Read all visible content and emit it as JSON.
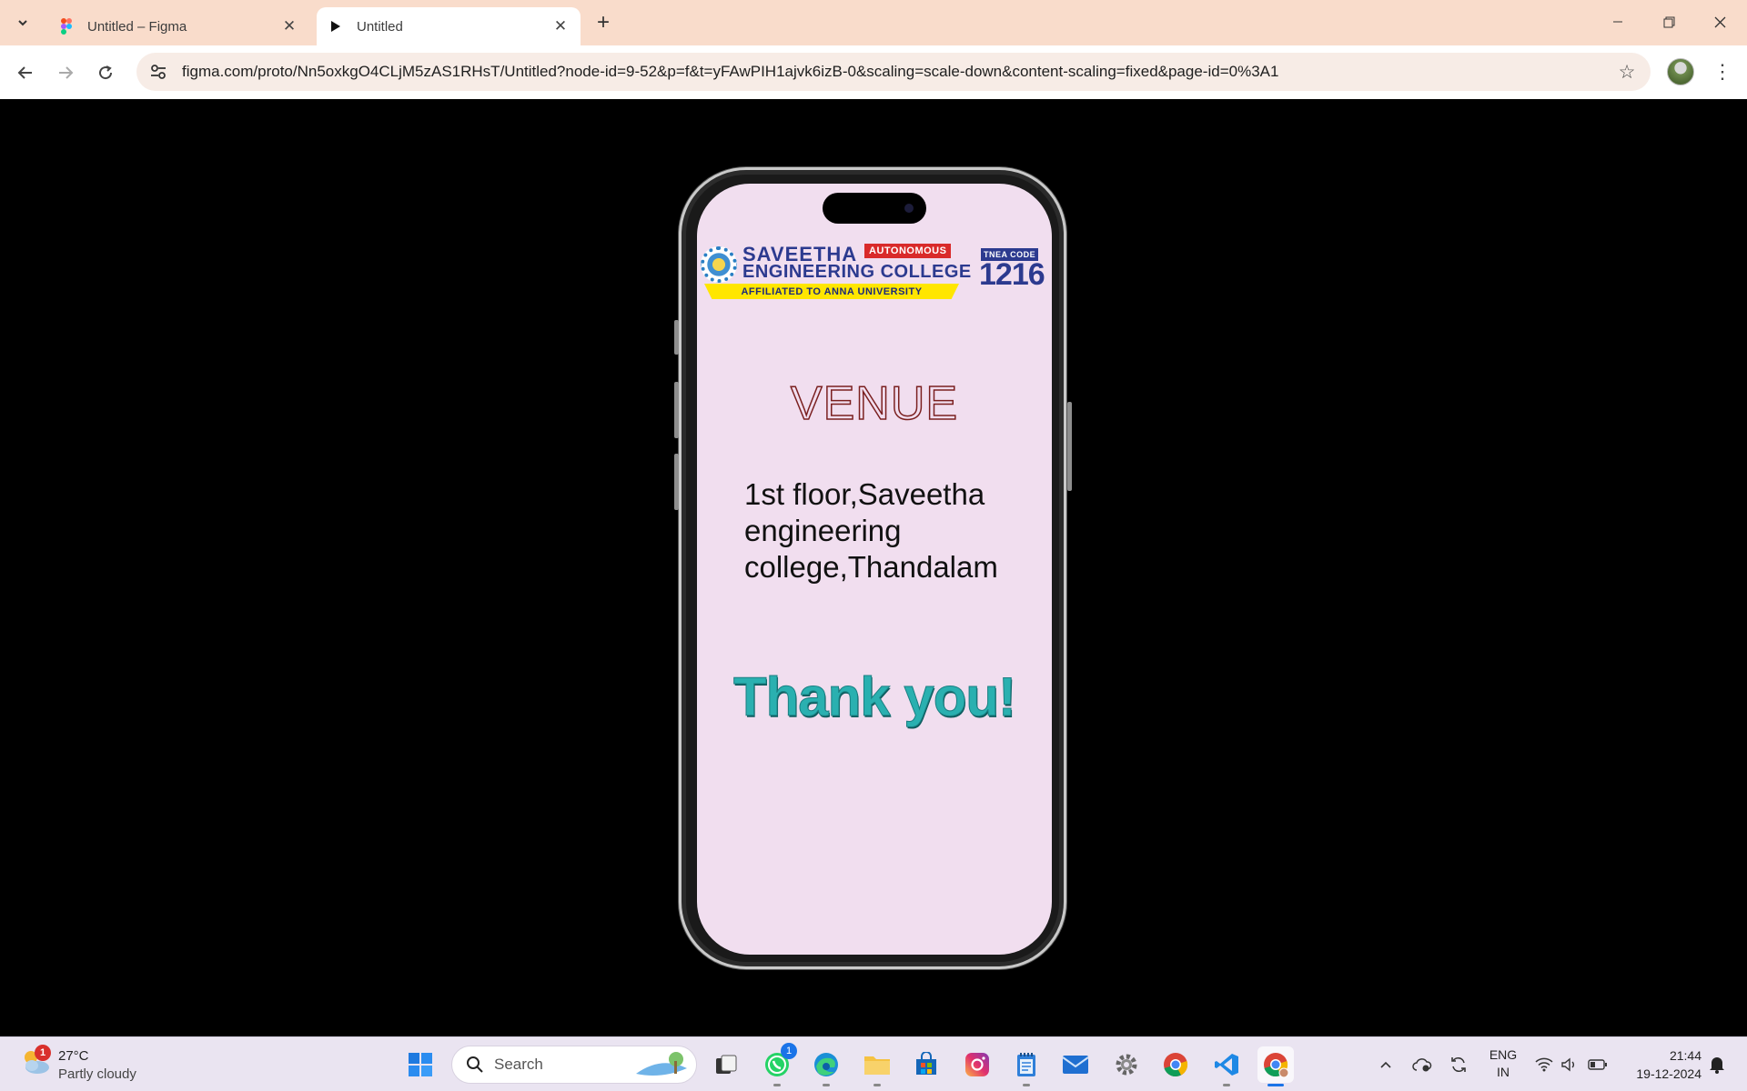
{
  "browser": {
    "tabs": [
      {
        "title": "Untitled – Figma",
        "active": false
      },
      {
        "title": "Untitled",
        "active": true
      }
    ],
    "url": "figma.com/proto/Nn5oxkgO4CLjM5zAS1RHsT/Untitled?node-id=9-52&p=f&t=yFAwPIH1ajvk6izB-0&scaling=scale-down&content-scaling=fixed&page-id=0%3A1"
  },
  "prototype": {
    "logo": {
      "name_line1": "SAVEETHA",
      "name_line2": "ENGINEERING COLLEGE",
      "badge": "AUTONOMOUS",
      "affiliation": "AFFILIATED TO ANNA UNIVERSITY",
      "code_label": "TNEA CODE",
      "code": "1216"
    },
    "heading": "VENUE",
    "address": "1st floor,Saveetha engineering college,Thandalam",
    "thanks": "Thank you!",
    "screen_color": "#f1deef"
  },
  "taskbar": {
    "weather": {
      "temp": "27°C",
      "condition": "Partly cloudy",
      "badge": "1"
    },
    "search_placeholder": "Search",
    "whatsapp_badge": "1",
    "language": {
      "line1": "ENG",
      "line2": "IN"
    },
    "time": "21:44",
    "date": "19-12-2024"
  }
}
